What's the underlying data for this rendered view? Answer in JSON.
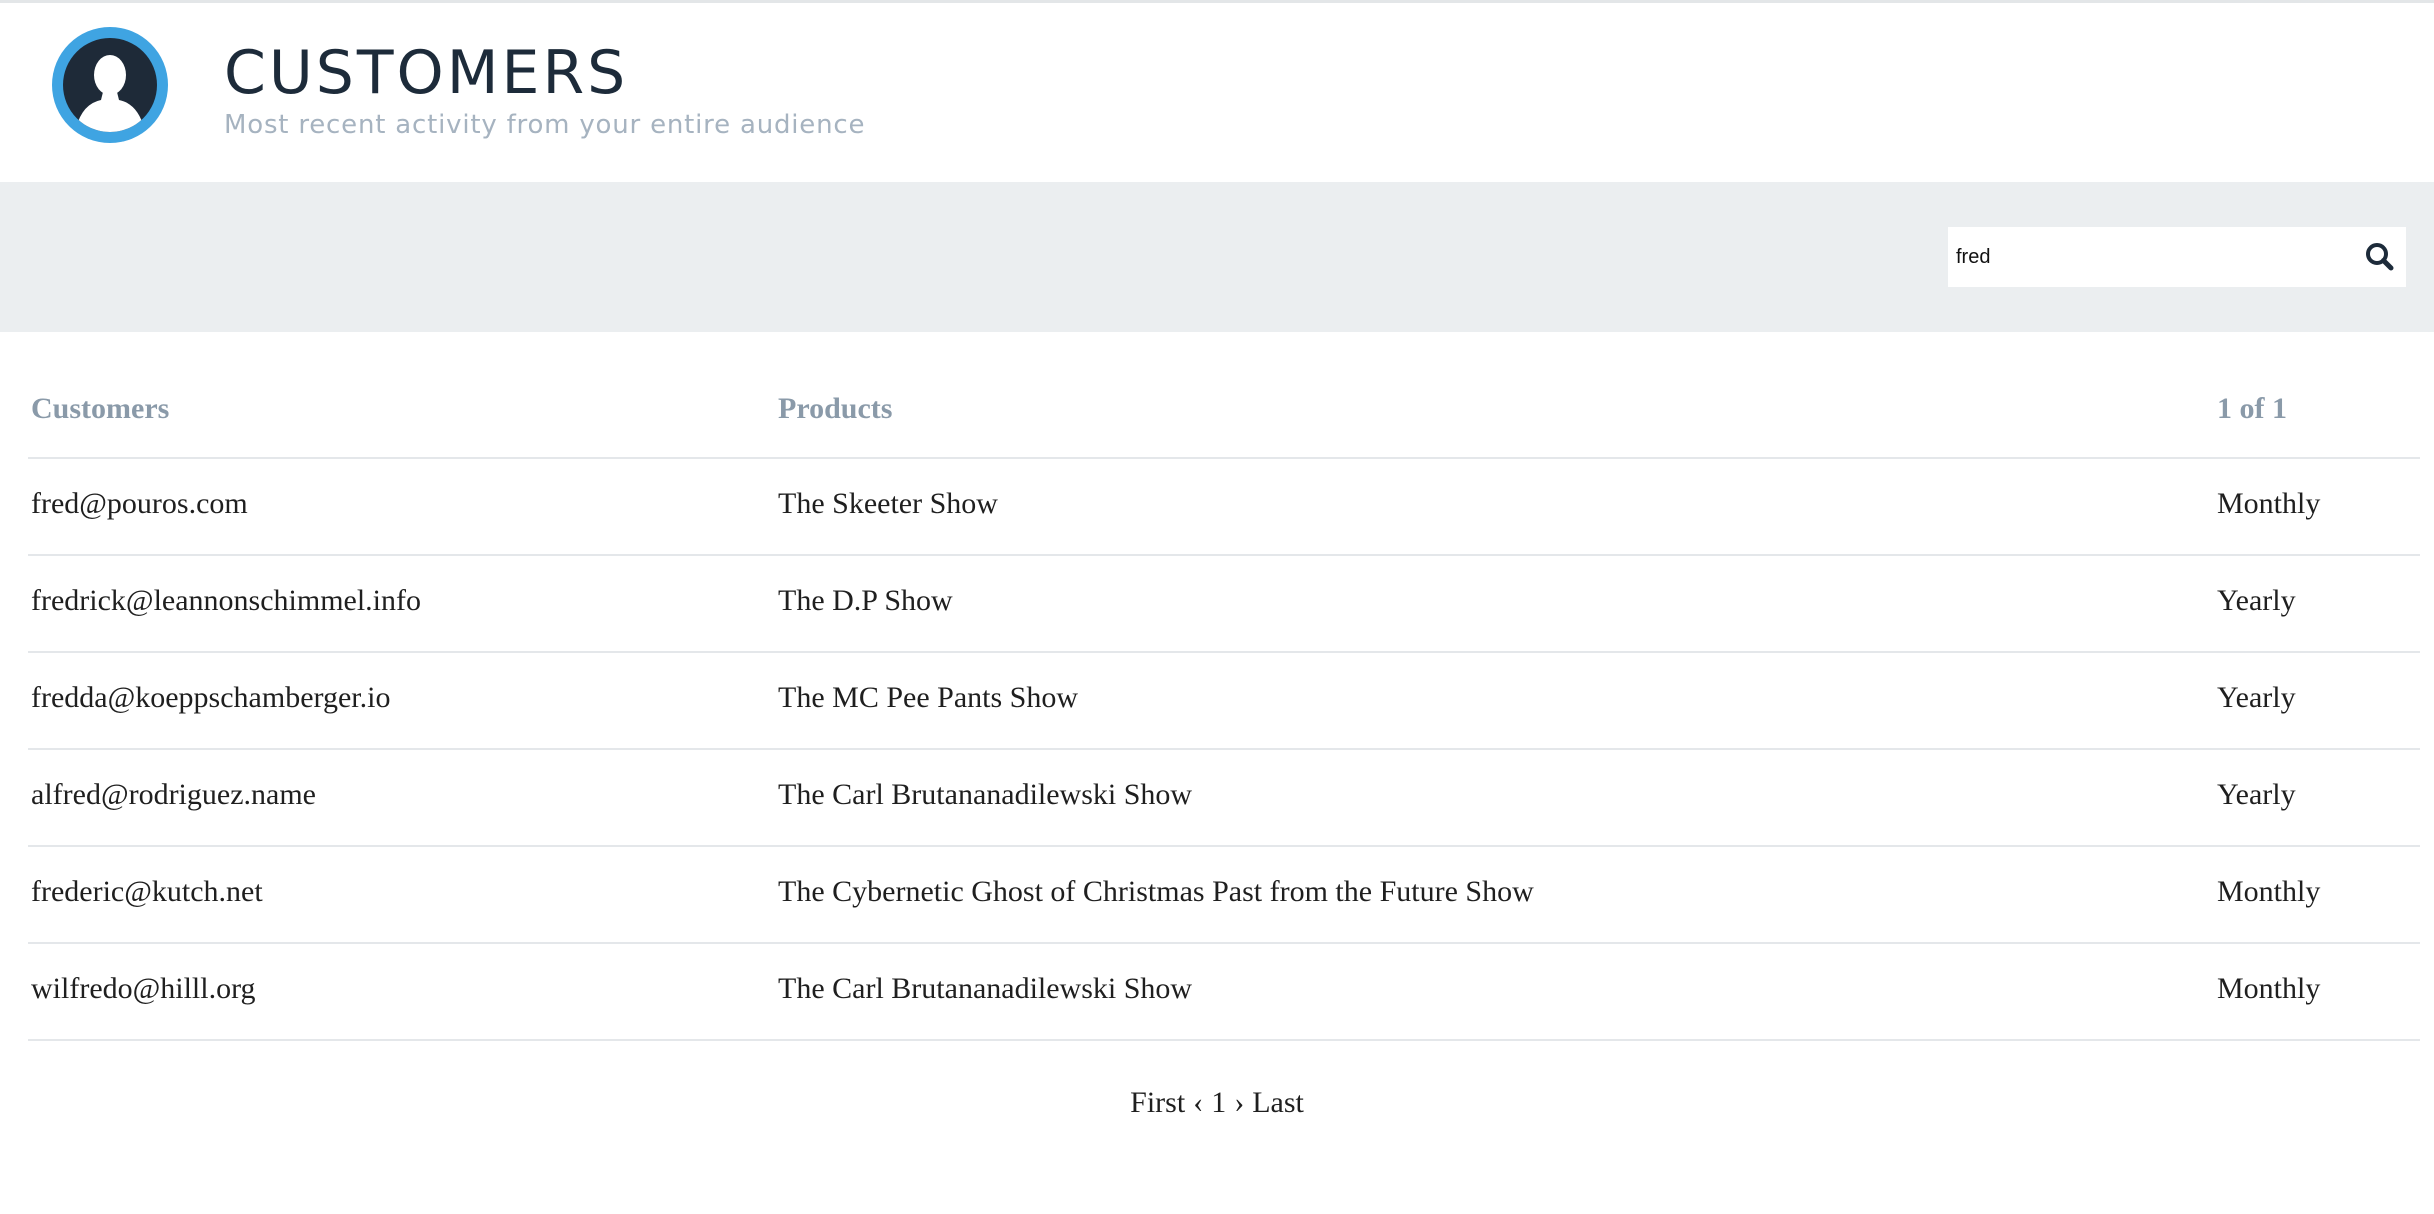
{
  "header": {
    "title": "CUSTOMERS",
    "subtitle": "Most recent activity from your entire audience",
    "avatar_icon": "user-silhouette-icon"
  },
  "search": {
    "value": "fred",
    "icon": "search-icon"
  },
  "table": {
    "columns": [
      "Customers",
      "Products",
      "1 of 1"
    ],
    "rows": [
      {
        "email": "fred@pouros.com",
        "product": "The Skeeter Show",
        "plan": "Monthly"
      },
      {
        "email": "fredrick@leannonschimmel.info",
        "product": "The D.P Show",
        "plan": "Yearly"
      },
      {
        "email": "fredda@koeppschamberger.io",
        "product": "The MC Pee Pants Show",
        "plan": "Yearly"
      },
      {
        "email": "alfred@rodriguez.name",
        "product": "The Carl Brutananadilewski Show",
        "plan": "Yearly"
      },
      {
        "email": "frederic@kutch.net",
        "product": "The Cybernetic Ghost of Christmas Past from the Future Show",
        "plan": "Monthly"
      },
      {
        "email": "wilfredo@hilll.org",
        "product": "The Carl Brutananadilewski Show",
        "plan": "Monthly"
      }
    ]
  },
  "pagination": {
    "first": "First",
    "prev": "‹",
    "page": "1",
    "next": "›",
    "last": "Last"
  },
  "colors": {
    "accent": "#3fa4e2",
    "dark": "#1d2b3a",
    "muted": "#a6b3c0",
    "band": "#ebeef0"
  }
}
